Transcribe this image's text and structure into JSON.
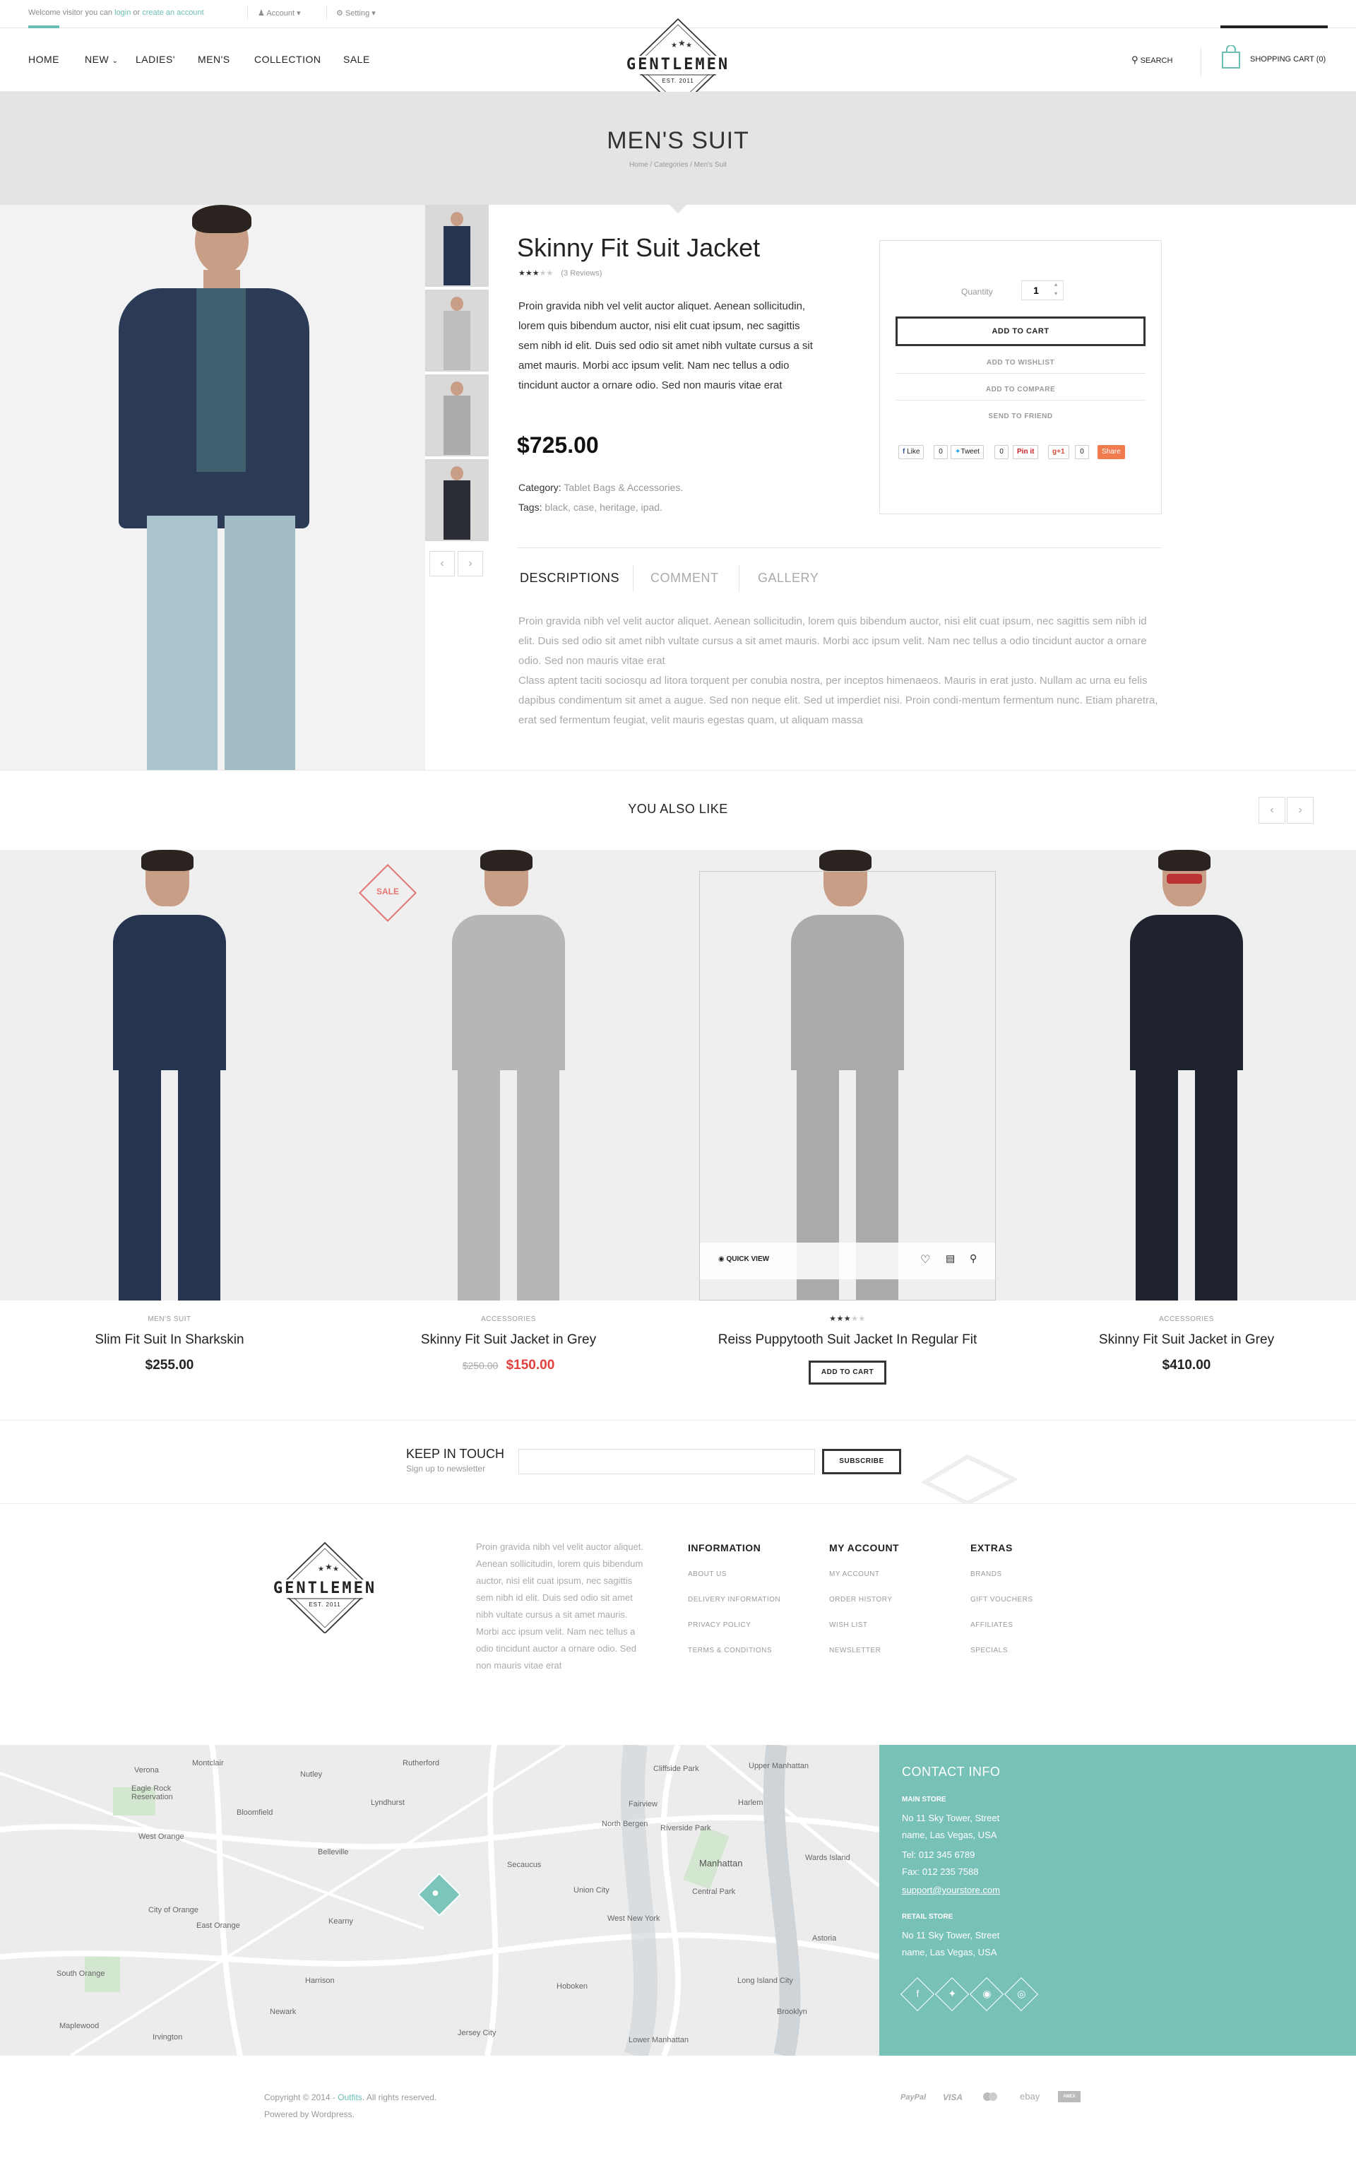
{
  "topbar": {
    "welcome_prefix": "Welcome visitor you can",
    "login": "login",
    "or": "or",
    "create_account": "create an account",
    "account": "Account",
    "setting": "Setting"
  },
  "nav": {
    "items": [
      "HOME",
      "NEW",
      "LADIES'",
      "MEN'S",
      "COLLECTION",
      "SALE"
    ],
    "logo_text": "GENTLEMEN",
    "logo_est": "EST. 2011",
    "search": "SEARCH",
    "cart": "SHOPPING CART (0)"
  },
  "banner": {
    "title": "MEN'S SUIT",
    "breadcrumb": [
      "Home",
      "Categories",
      "Men's Suit"
    ]
  },
  "product": {
    "title": "Skinny Fit Suit Jacket",
    "rating": 3,
    "reviews": "(3 Reviews)",
    "description": "Proin gravida nibh vel velit auctor aliquet. Aenean sollicitudin, lorem quis bibendum auctor, nisi elit cuat ipsum, nec sagittis sem nibh id elit. Duis sed odio sit amet nibh vultate cursus a sit amet mauris. Morbi acc ipsum velit. Nam nec tellus a odio tincidunt auctor a ornare odio. Sed non  mauris vitae erat",
    "price": "$725.00",
    "category_label": "Category:",
    "category_value": "Tablet Bags & Accessories.",
    "tags_label": "Tags:",
    "tags_value": "black, case, heritage, ipad."
  },
  "cartbox": {
    "quantity_label": "Quantity",
    "quantity_value": "1",
    "add_to_cart": "ADD TO CART",
    "wishlist": "ADD TO WISHLIST",
    "compare": "ADD TO COMPARE",
    "send": "SEND TO FRIEND",
    "share": {
      "like": "Like",
      "like_count": "0",
      "tweet": "Tweet",
      "tweet_count": "0",
      "pinit": "Pin it",
      "gplus": "+1",
      "gplus_count": "0",
      "share": "Share"
    }
  },
  "tabs": {
    "items": [
      "DESCRIPTIONS",
      "COMMENT",
      "GALLERY"
    ],
    "text": "Proin gravida nibh vel velit auctor aliquet. Aenean sollicitudin, lorem quis bibendum auctor, nisi elit cuat ipsum, nec sagittis sem nibh id elit. Duis sed odio sit amet nibh vultate cursus a sit amet mauris. Morbi acc ipsum velit. Nam nec tellus a odio tincidunt auctor a ornare odio. Sed non  mauris vitae erat\nClass aptent taciti sociosqu ad litora torquent per conubia nostra, per inceptos himenaeos. Mauris in erat justo. Nullam ac urna eu felis dapibus condimentum sit amet a augue. Sed non neque elit. Sed ut imperdiet nisi. Proin condi-mentum fermentum nunc. Etiam pharetra, erat sed fermentum feugiat, velit mauris egestas quam, ut aliquam massa"
  },
  "related": {
    "title": "YOU ALSO LIKE",
    "products": [
      {
        "category": "MEN'S SUIT",
        "name": "Slim Fit Suit In Sharkskin",
        "price": "$255.00",
        "old_price": "",
        "suit_color": "#27344f"
      },
      {
        "category": "ACCESSORIES",
        "name": "Skinny Fit Suit Jacket in Grey",
        "price": "$150.00",
        "old_price": "$250.00",
        "suit_color": "#b5b6b8",
        "badge": "SALE"
      },
      {
        "category": "",
        "name": "Reiss Puppytooth Suit Jacket In Regular Fit",
        "price": "",
        "old_price": "",
        "suit_color": "#a9abad",
        "rating": 3,
        "quick_view": "QUICK VIEW",
        "add_to_cart": "ADD TO CART"
      },
      {
        "category": "ACCESSORIES",
        "name": "Skinny Fit Suit Jacket in Grey",
        "price": "$410.00",
        "old_price": "",
        "suit_color": "#1f2330"
      }
    ]
  },
  "newsletter": {
    "title": "KEEP IN TOUCH",
    "subtitle": "Sign up to newsletter",
    "button": "SUBSCRIBE"
  },
  "footer": {
    "about": "Proin gravida nibh vel velit auctor aliquet. Aenean sollicitudin, lorem quis bibendum auctor, nisi elit cuat ipsum, nec sagittis sem nibh id elit. Duis sed odio sit amet nibh vultate cursus a sit amet mauris. Morbi acc ipsum velit. Nam nec tellus a odio tincidunt auctor a ornare odio. Sed non  mauris vitae erat",
    "columns": [
      {
        "title": "INFORMATION",
        "links": [
          "ABOUT US",
          "DELIVERY INFORMATION",
          "PRIVACY POLICY",
          "TERMS & CONDITIONS"
        ]
      },
      {
        "title": "MY ACCOUNT",
        "links": [
          "MY ACCOUNT",
          "ORDER HISTORY",
          "WISH LIST",
          "NEWSLETTER"
        ]
      },
      {
        "title": "EXTRAS",
        "links": [
          "BRANDS",
          "GIFT VOUCHERS",
          "AFFILIATES",
          "SPECIALS"
        ]
      }
    ]
  },
  "contact": {
    "title": "CONTACT INFO",
    "main_label": "MAIN STORE",
    "main_addr1": "No 11 Sky Tower, Street",
    "main_addr2": "name, Las Vegas, USA",
    "tel": "Tel: 012 345 6789",
    "fax": "Fax: 012 235 7588",
    "email": "support@yourstore.com",
    "retail_label": "RETAIL STORE",
    "retail_addr1": "No 11 Sky Tower, Street",
    "retail_addr2": "name, Las Vegas, USA",
    "accent": "#78c1b7"
  },
  "map": {
    "places": [
      "Verona",
      "Montclair",
      "Nutley",
      "Rutherford",
      "Cliffside Park",
      "Upper Manhattan",
      "Eagle Rock Reservation",
      "Bloomfield",
      "Lyndhurst",
      "Fairview",
      "Harlem",
      "West Orange",
      "Belleville",
      "North Bergen",
      "Riverside Park",
      "Manhattan",
      "East Orange",
      "Secaucus",
      "Union City",
      "Wards Island",
      "Kearny",
      "City of Orange",
      "West New York",
      "Central Park",
      "Hoboken",
      "Long Island City",
      "Harrison",
      "Newark",
      "Jersey City",
      "Brooklyn",
      "Maplewood",
      "Irvington",
      "Lower Manhattan",
      "South Orange",
      "Astoria"
    ]
  },
  "bottom": {
    "copyright_prefix": "Copyright © 2014 - ",
    "brand": "Outfits",
    "copyright_suffix": ". All rights reserved.",
    "powered": "Powered by Wordpress.",
    "payments": [
      "PayPal",
      "VISA",
      "MasterCard",
      "ebay",
      "AMEX"
    ]
  }
}
